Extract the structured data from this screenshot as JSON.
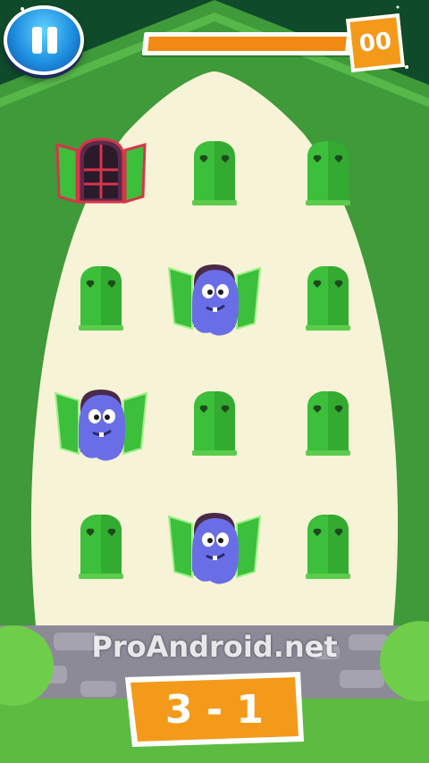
{
  "hud": {
    "pause_icon": "pause-icon",
    "progress_fraction": 0.97,
    "score": "00"
  },
  "board": {
    "rows": 4,
    "cols": 3,
    "cells": [
      {
        "state": "open-empty",
        "row": 1,
        "col": 1
      },
      {
        "state": "closed",
        "row": 1,
        "col": 2
      },
      {
        "state": "closed",
        "row": 1,
        "col": 3
      },
      {
        "state": "closed",
        "row": 2,
        "col": 1
      },
      {
        "state": "open-ghost",
        "row": 2,
        "col": 2
      },
      {
        "state": "closed",
        "row": 2,
        "col": 3
      },
      {
        "state": "open-ghost",
        "row": 3,
        "col": 1
      },
      {
        "state": "closed",
        "row": 3,
        "col": 2
      },
      {
        "state": "closed",
        "row": 3,
        "col": 3
      },
      {
        "state": "closed",
        "row": 4,
        "col": 1
      },
      {
        "state": "open-ghost",
        "row": 4,
        "col": 2
      },
      {
        "state": "closed",
        "row": 4,
        "col": 3
      }
    ]
  },
  "footer": {
    "watermark": "ProAndroid.net",
    "level": "3 - 1"
  },
  "colors": {
    "background_dark": "#0f4a2a",
    "hill_green": "#3f9a3a",
    "wall_cream": "#f7f3d6",
    "shutter_green": "#3cbf3a",
    "ghost_blue": "#6a6ee6",
    "accent_orange": "#f39a1a",
    "pause_blue": "#1f8fe0"
  }
}
